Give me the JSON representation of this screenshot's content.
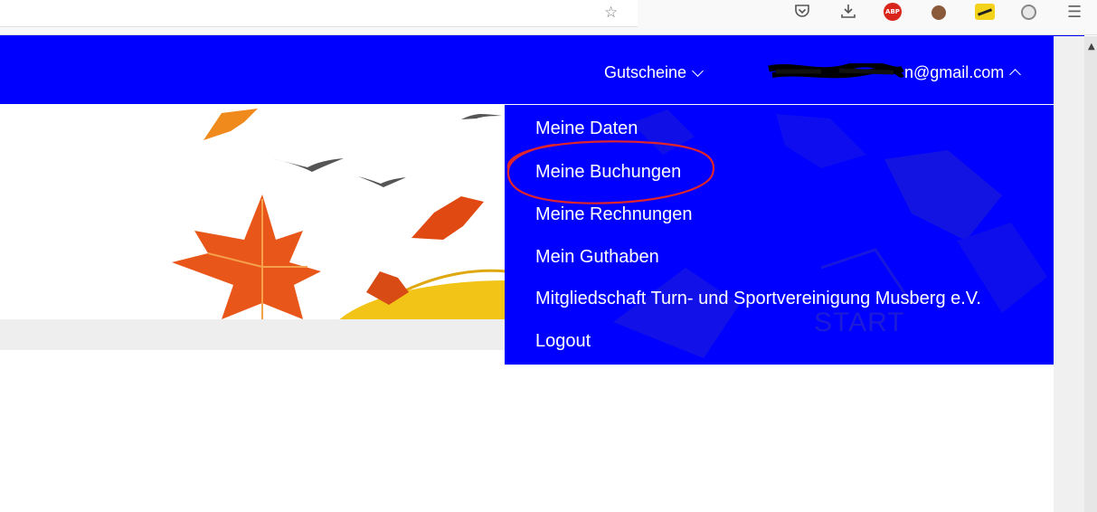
{
  "header": {
    "gutscheine_label": "Gutscheine",
    "account_email_visible": "n@gmail.com"
  },
  "dropdown": {
    "items": [
      "Meine Daten",
      "Meine Buchungen",
      "Meine Rechnungen",
      "Mein Guthaben",
      "Mitgliedschaft Turn- und Sportvereinigung Musberg e.V.",
      "Logout"
    ],
    "watermark": "START"
  },
  "toolbar": {
    "abp_label": "ABP",
    "icons": [
      "star-icon",
      "pocket-icon",
      "download-icon",
      "adblock-icon",
      "cookie-icon",
      "extension-icon",
      "extension-icon",
      "hamburger-menu-icon"
    ]
  },
  "colors": {
    "header_bg": "#0000ff",
    "annotation": "#e0242b"
  }
}
